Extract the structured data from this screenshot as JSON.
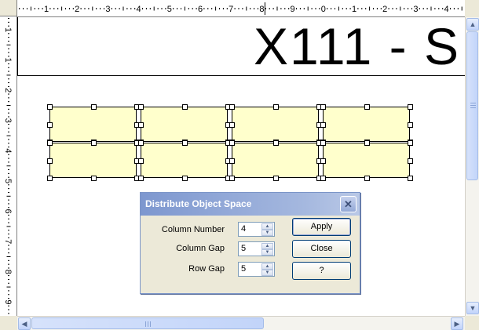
{
  "ruler": {
    "h_labels": [
      "1",
      "2",
      "3",
      "4",
      "5",
      "6",
      "7",
      "8",
      "9",
      "0",
      "1",
      "2",
      "3",
      "4"
    ],
    "v_labels": [
      "1",
      "1",
      "2",
      "3",
      "4",
      "5",
      "6",
      "7",
      "8",
      "9"
    ]
  },
  "document": {
    "title_text": "X111 - S"
  },
  "dialog": {
    "title": "Distribute Object Space",
    "close_label": "✕",
    "fields": [
      {
        "label": "Column Number",
        "value": "4"
      },
      {
        "label": "Column Gap",
        "value": "5"
      },
      {
        "label": "Row Gap",
        "value": "5"
      }
    ],
    "buttons": {
      "apply": "Apply",
      "close": "Close",
      "help": "?"
    }
  },
  "scrollbars": {
    "up_arrow": "▲",
    "down_arrow": "▼",
    "left_arrow": "◀",
    "right_arrow": "▶"
  },
  "colors": {
    "object_fill": "#ffffcc",
    "dialog_title_start": "#7d97cf",
    "dialog_bg": "#ece9d8"
  }
}
